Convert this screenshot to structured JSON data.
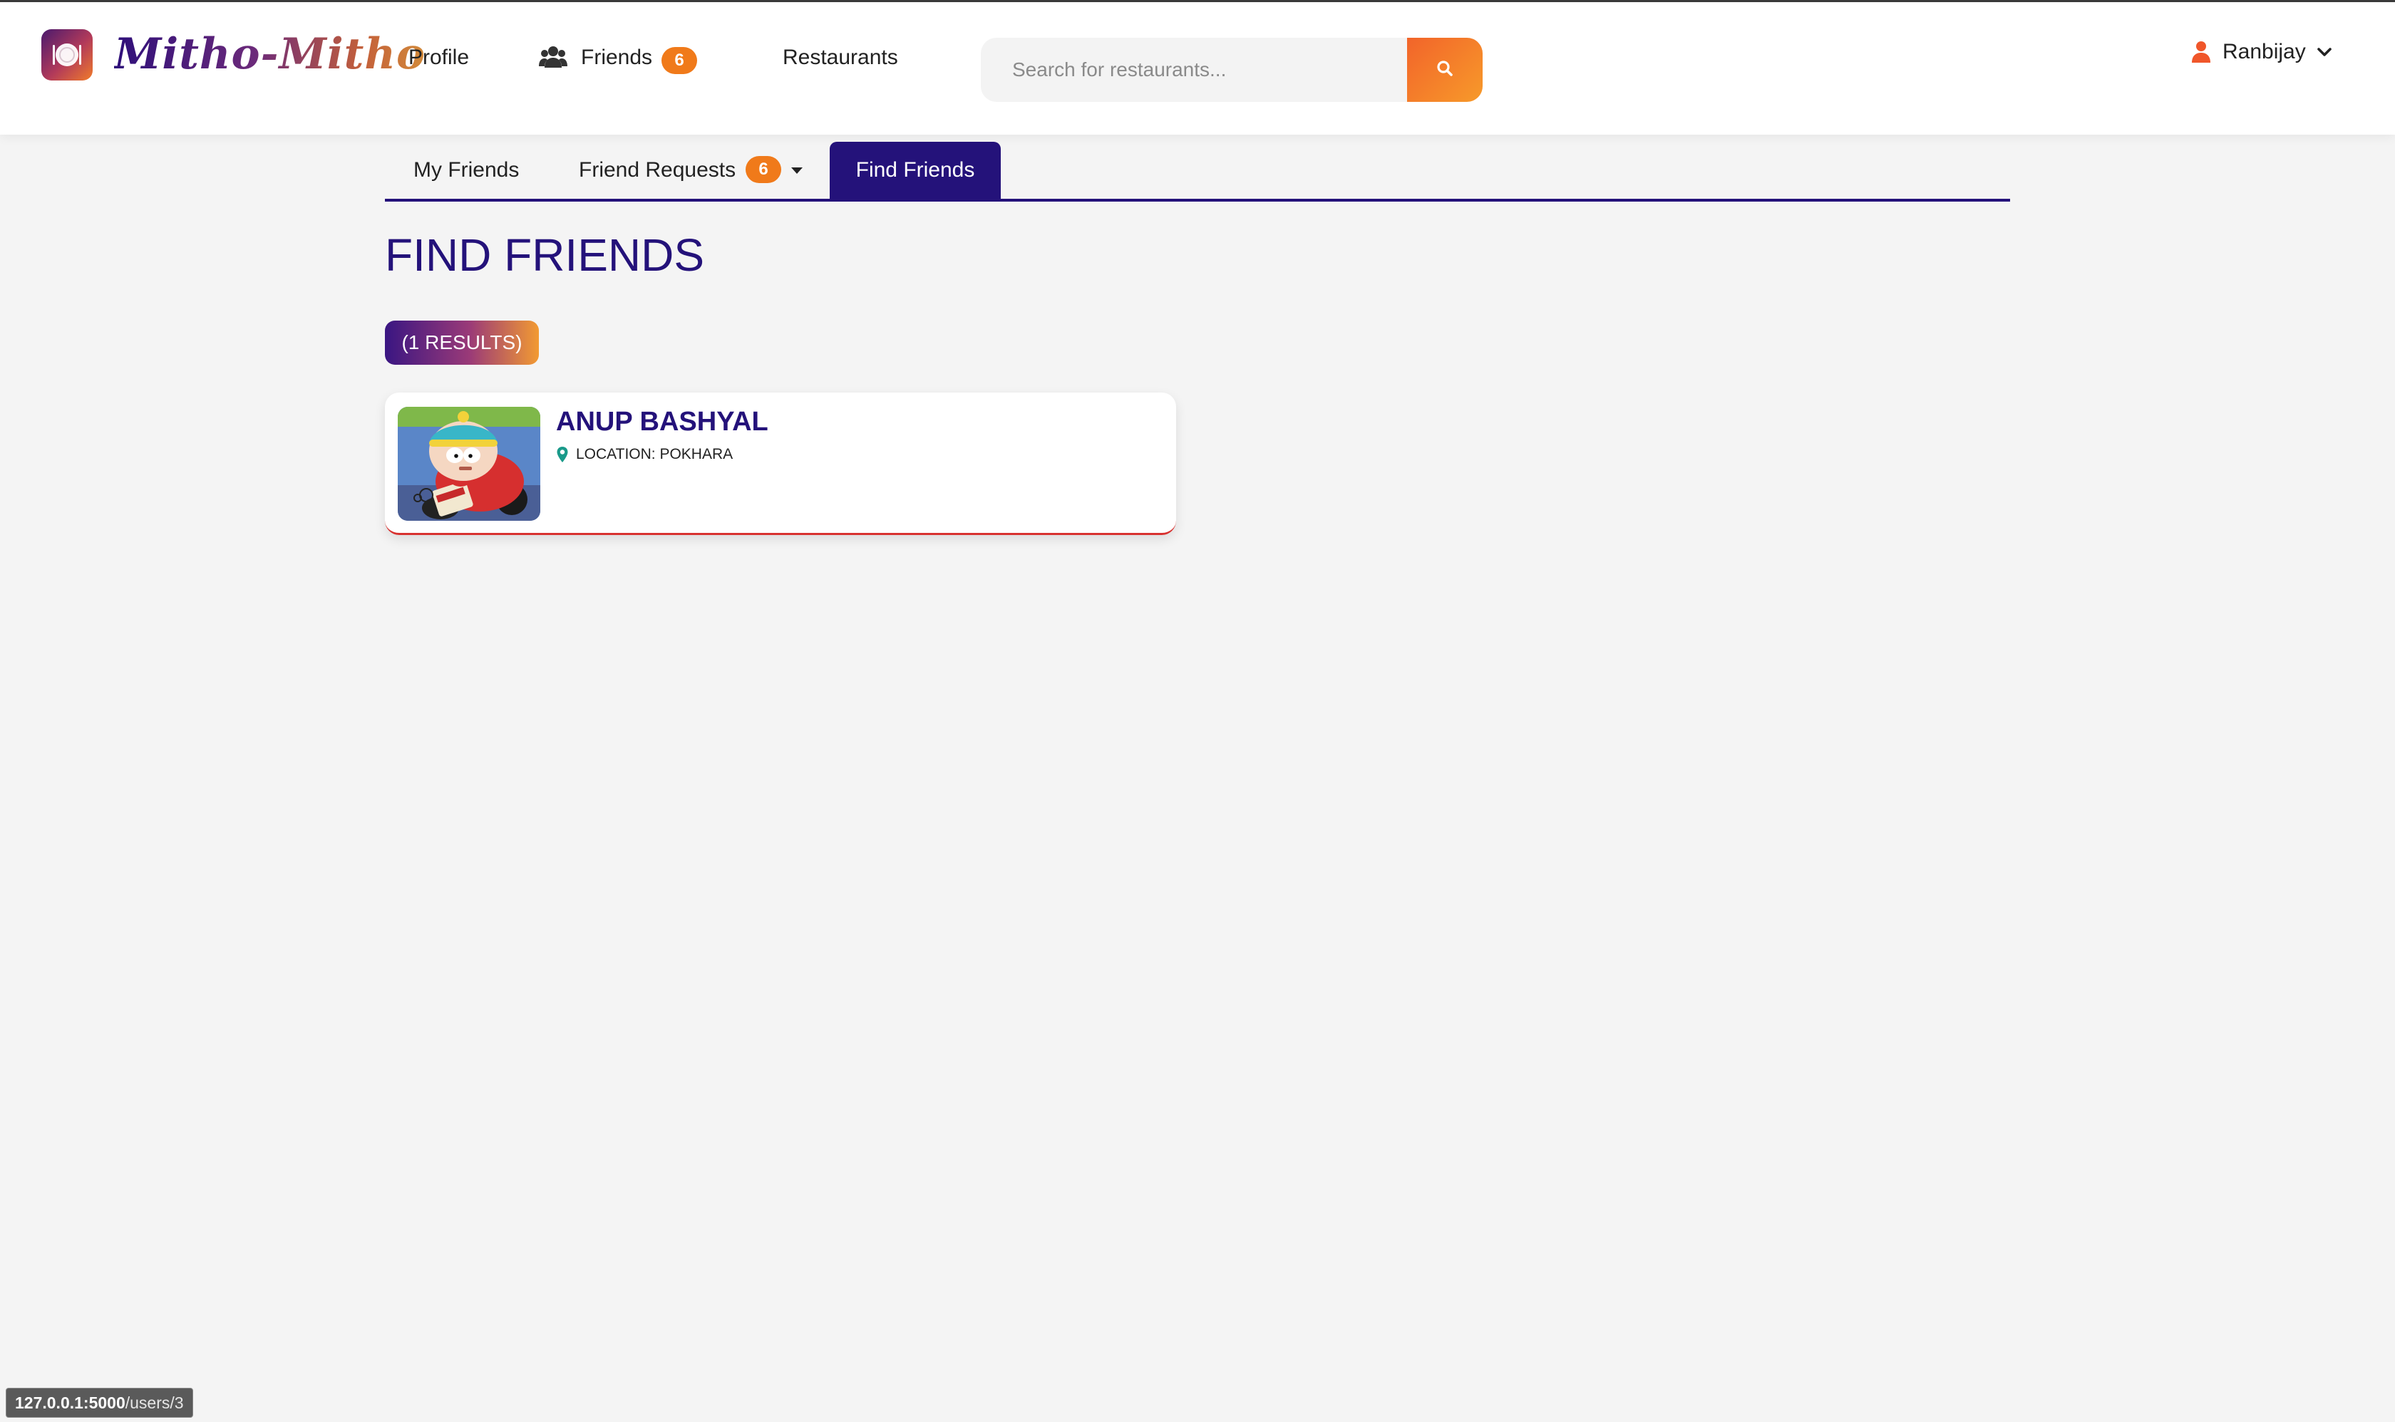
{
  "brand": {
    "name": "Mitho-Mitho",
    "icon": "plate-logo-icon"
  },
  "nav": {
    "profile": "Profile",
    "friends": "Friends",
    "friends_icon": "users-icon",
    "friends_badge": "6",
    "restaurants": "Restaurants"
  },
  "search": {
    "placeholder": "Search for restaurants...",
    "value": "",
    "icon": "search-icon"
  },
  "user": {
    "name": "Ranbijay",
    "icon": "user-icon",
    "chevron": "chevron-down-icon"
  },
  "tabs": {
    "my_friends": "My Friends",
    "friend_requests": "Friend Requests",
    "friend_requests_badge": "6",
    "find_friends": "Find Friends",
    "active": "find_friends"
  },
  "page": {
    "title": "FIND FRIENDS",
    "results": "(1 RESULTS)"
  },
  "results": [
    {
      "name": "ANUP BASHYAL",
      "location": "LOCATION: POKHARA",
      "location_icon": "map-pin-icon"
    }
  ],
  "status_bar": {
    "host": "127.0.0.1:5000",
    "path": "/users/3"
  },
  "colors": {
    "primary": "#24127a",
    "accent": "#f07a1a",
    "card_border": "#d8312f",
    "background": "#f4f4f4"
  }
}
